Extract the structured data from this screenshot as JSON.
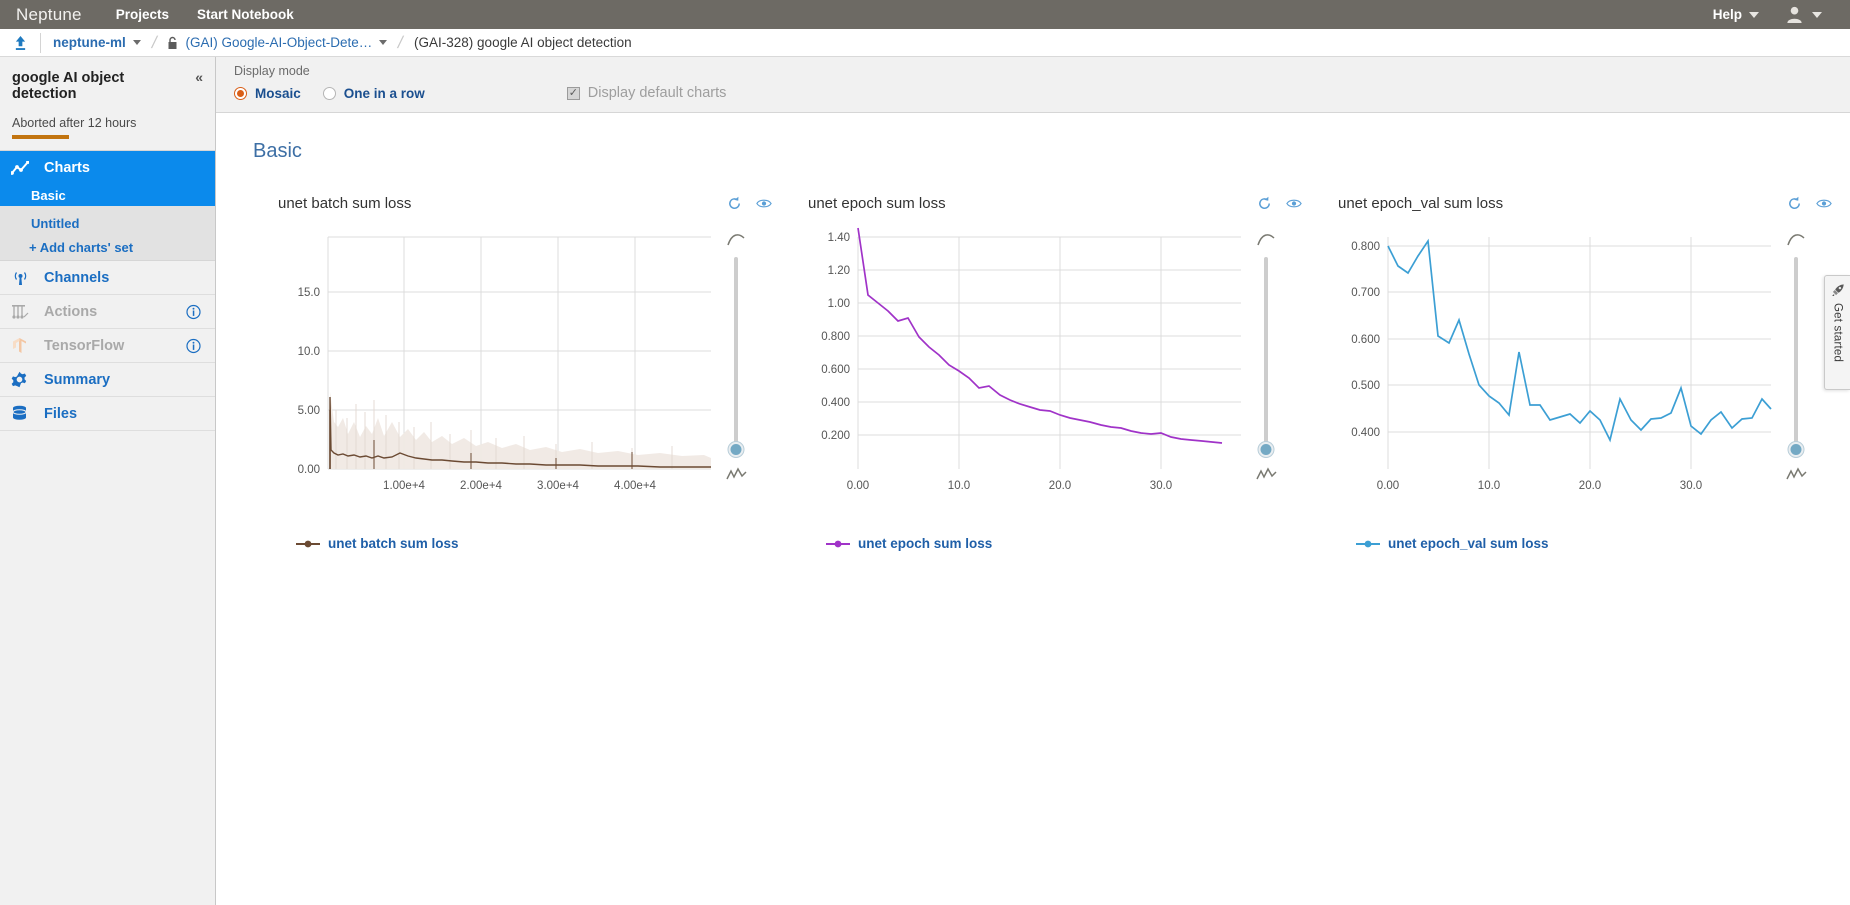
{
  "topbar": {
    "brand": "Neptune",
    "nav": [
      {
        "label": "Projects"
      },
      {
        "label": "Start Notebook"
      }
    ],
    "help_label": "Help",
    "brand_bg": "#6d6a64"
  },
  "breadcrumb": {
    "home_icon": "upload-home-icon",
    "workspace": "neptune-ml",
    "project_lock_icon": "lock-icon",
    "project": "(GAI) Google-AI-Object-Dete…",
    "current": "(GAI-328) google AI object detection"
  },
  "sidebar": {
    "experiment_title": "google AI object detection",
    "collapse_icon": "collapse-left-icon",
    "status_text": "Aborted after 12 hours",
    "status_color": "#c2740f",
    "items": [
      {
        "label": "Charts",
        "icon": "chart-line-icon",
        "active": true,
        "disabled": false,
        "info": false
      },
      {
        "label": "Channels",
        "icon": "broadcast-icon",
        "active": false,
        "disabled": false,
        "info": false
      },
      {
        "label": "Actions",
        "icon": "actions-icon",
        "active": false,
        "disabled": true,
        "info": true
      },
      {
        "label": "TensorFlow",
        "icon": "tensorflow-icon",
        "active": false,
        "disabled": true,
        "info": true
      },
      {
        "label": "Summary",
        "icon": "gear-icon",
        "active": false,
        "disabled": false,
        "info": false
      },
      {
        "label": "Files",
        "icon": "database-icon",
        "active": false,
        "disabled": false,
        "info": false
      }
    ],
    "chart_sets": [
      {
        "label": "Basic",
        "active": true
      },
      {
        "label": "Untitled",
        "active": false
      },
      {
        "label": "+ Add charts' set",
        "active": false
      }
    ]
  },
  "toolbar": {
    "display_mode_label": "Display mode",
    "mosaic_label": "Mosaic",
    "one_in_a_row_label": "One in a row",
    "default_charts_label": "Display default charts",
    "mosaic_selected": true,
    "default_charts_checked": true,
    "accent_color": "#d95f18"
  },
  "main": {
    "section_title": "Basic"
  },
  "get_started": {
    "label": "Get started",
    "icon": "rocket-icon"
  },
  "chart_icons": {
    "reset": "reset-zoom-icon",
    "visibility": "eye-icon",
    "smooth_top": "smooth-curve-icon",
    "smooth_bottom": "raw-zigzag-icon"
  },
  "chart_data": [
    {
      "type": "line",
      "title": "unet batch sum loss",
      "legend": [
        "unet batch sum loss"
      ],
      "legend_position": "bottom-left",
      "color": "#6b4a33",
      "band_color": "#efe8e3",
      "xlabel": "",
      "ylabel": "",
      "grid": true,
      "xlim": [
        0,
        47000
      ],
      "ylim": [
        0,
        18.5
      ],
      "xticks": [
        0,
        10000,
        20000,
        30000,
        40000
      ],
      "xticklabels": [
        "",
        "1.00e+4",
        "2.00e+4",
        "3.00e+4",
        "4.00e+4"
      ],
      "yticks": [
        0,
        5,
        10,
        15
      ],
      "yticklabels": [
        "0.00",
        "5.00",
        "10.0",
        "15.0"
      ],
      "x": [
        0,
        300,
        700,
        1200,
        1800,
        2500,
        3400,
        4300,
        5200,
        6100,
        7000,
        8000,
        9000,
        10000,
        11500,
        13000,
        14500,
        16000,
        18000,
        20000,
        22000,
        24000,
        26000,
        28000,
        30000,
        32000,
        34000,
        36000,
        38000,
        40000,
        42000,
        44000,
        46000,
        47000
      ],
      "values": [
        6.1,
        1.45,
        1.15,
        1.02,
        0.95,
        0.88,
        0.82,
        0.74,
        0.66,
        0.6,
        0.58,
        0.62,
        0.58,
        0.53,
        0.48,
        0.44,
        0.4,
        0.37,
        0.33,
        0.31,
        0.28,
        0.26,
        0.24,
        0.22,
        0.2,
        0.19,
        0.18,
        0.17,
        0.16,
        0.15,
        0.15,
        0.14,
        0.13,
        0.13
      ],
      "spikes": [
        {
          "x": 1800,
          "y": 3.0
        },
        {
          "x": 3400,
          "y": 2.6
        },
        {
          "x": 5200,
          "y": 2.9
        },
        {
          "x": 6100,
          "y": 2.1
        },
        {
          "x": 16000,
          "y": 1.4
        },
        {
          "x": 21000,
          "y": 1.1
        },
        {
          "x": 27000,
          "y": 0.9
        },
        {
          "x": 38500,
          "y": 1.45
        }
      ]
    },
    {
      "type": "line",
      "title": "unet epoch sum loss",
      "legend": [
        "unet epoch sum loss"
      ],
      "legend_position": "bottom-left",
      "color": "#a033c8",
      "xlabel": "",
      "ylabel": "",
      "grid": true,
      "xlim": [
        0,
        37
      ],
      "ylim": [
        0.1,
        1.5
      ],
      "xticks": [
        0,
        10,
        20,
        30
      ],
      "xticklabels": [
        "0.00",
        "10.0",
        "20.0",
        "30.0"
      ],
      "yticks": [
        0.2,
        0.4,
        0.6,
        0.8,
        1.0,
        1.2,
        1.4
      ],
      "yticklabels": [
        "0.200",
        "0.400",
        "0.600",
        "0.800",
        "1.00",
        "1.20",
        "1.40"
      ],
      "x": [
        0,
        1,
        2,
        3,
        4,
        5,
        6,
        7,
        8,
        9,
        10,
        11,
        12,
        13,
        14,
        15,
        16,
        17,
        18,
        19,
        20,
        21,
        22,
        23,
        24,
        25,
        26,
        27,
        28,
        29,
        30,
        31,
        32,
        33,
        34,
        35,
        36
      ],
      "values": [
        1.45,
        1.05,
        1.0,
        0.95,
        0.89,
        0.91,
        0.79,
        0.73,
        0.68,
        0.62,
        0.585,
        0.545,
        0.485,
        0.5,
        0.46,
        0.43,
        0.405,
        0.39,
        0.375,
        0.365,
        0.345,
        0.33,
        0.315,
        0.3,
        0.285,
        0.275,
        0.265,
        0.25,
        0.235,
        0.228,
        0.24,
        0.215,
        0.2,
        0.195,
        0.188,
        0.18,
        0.172
      ]
    },
    {
      "type": "line",
      "title": "unet epoch_val sum loss",
      "legend": [
        "unet epoch_val sum loss"
      ],
      "legend_position": "bottom-left",
      "color": "#3c9fd4",
      "xlabel": "",
      "ylabel": "",
      "grid": true,
      "xlim": [
        0,
        37
      ],
      "ylim": [
        0.355,
        0.825
      ],
      "xticks": [
        0,
        10,
        20,
        30
      ],
      "xticklabels": [
        "0.00",
        "10.0",
        "20.0",
        "30.0"
      ],
      "yticks": [
        0.4,
        0.5,
        0.6,
        0.7,
        0.8
      ],
      "yticklabels": [
        "0.400",
        "0.500",
        "0.600",
        "0.700",
        "0.800"
      ],
      "x": [
        0,
        1,
        2,
        3,
        4,
        5,
        6,
        7,
        8,
        9,
        10,
        11,
        12,
        13,
        14,
        15,
        16,
        17,
        18,
        19,
        20,
        21,
        22,
        23,
        24,
        25,
        26,
        27,
        28,
        29,
        30,
        31,
        32,
        33,
        34,
        35,
        36
      ],
      "values": [
        0.8,
        0.757,
        0.743,
        0.778,
        0.811,
        0.607,
        0.591,
        0.639,
        0.567,
        0.502,
        0.478,
        0.463,
        0.437,
        0.573,
        0.443,
        0.443,
        0.411,
        0.418,
        0.423,
        0.405,
        0.445,
        0.426,
        0.382,
        0.471,
        0.411,
        0.389,
        0.417,
        0.419,
        0.43,
        0.494,
        0.414,
        0.397,
        0.423,
        0.44,
        0.407,
        0.427,
        0.429,
        0.471,
        0.45
      ]
    }
  ]
}
